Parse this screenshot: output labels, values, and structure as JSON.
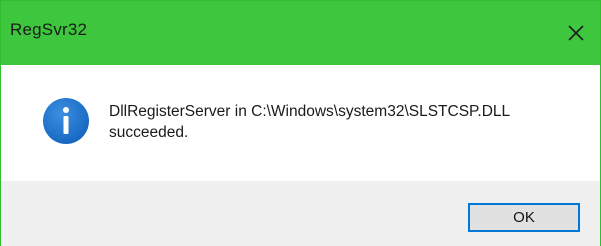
{
  "window": {
    "title": "RegSvr32",
    "close_icon": "close-icon",
    "title_bar_color": "#3ec73e"
  },
  "dialog": {
    "icon": "info-icon",
    "icon_color": "#1976d2",
    "message_line1": "DllRegisterServer in C:\\Windows\\system32\\SLSTCSP.DLL",
    "message_line2": "succeeded."
  },
  "footer": {
    "ok_label": "OK"
  }
}
